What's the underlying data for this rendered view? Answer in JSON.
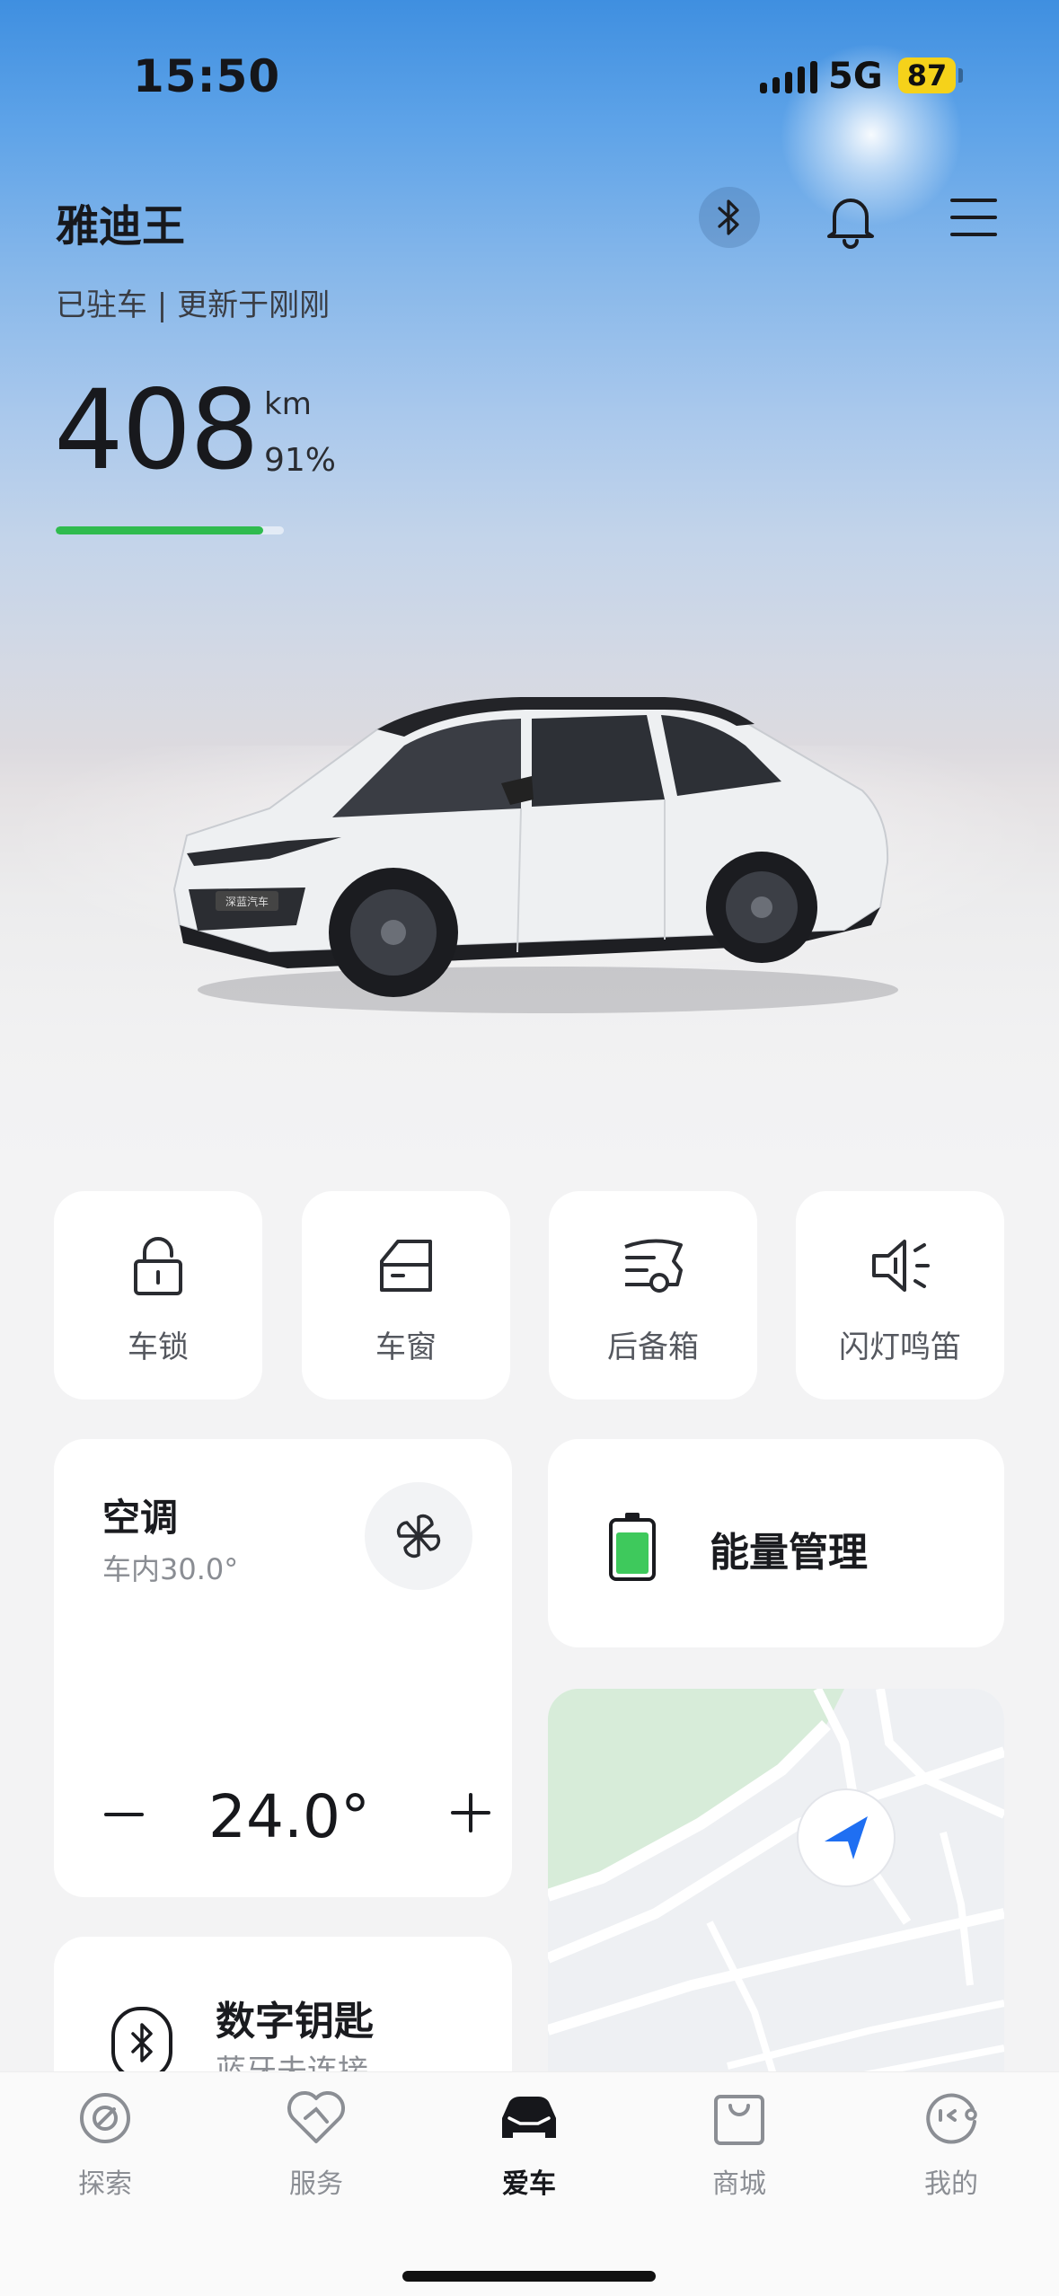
{
  "status_bar": {
    "time": "15:50",
    "network": "5G",
    "battery": "87",
    "battery_color": "#f5d21a"
  },
  "header": {
    "car_name": "雅迪王",
    "status": "已驻车 | 更新于刚刚",
    "icons": [
      "bluetooth-icon",
      "bell-icon",
      "menu-icon"
    ]
  },
  "range": {
    "value": "408",
    "unit": "km",
    "battery_percent": "91%",
    "bar_fill_percent": 91,
    "bar_color": "#2fbb4f"
  },
  "car_image": {
    "badge_text": "深蓝汽车"
  },
  "quick_actions": [
    {
      "label": "车锁",
      "icon": "lock-icon"
    },
    {
      "label": "车窗",
      "icon": "car-window-icon"
    },
    {
      "label": "后备箱",
      "icon": "trunk-icon"
    },
    {
      "label": "闪灯鸣笛",
      "icon": "horn-light-icon"
    }
  ],
  "climate": {
    "title": "空调",
    "cabin_temp": "车内30.0°",
    "set_temp": "24.0°",
    "icon": "fan-icon"
  },
  "energy": {
    "label": "能量管理",
    "icon": "battery-icon"
  },
  "map": {
    "icon": "navigation-arrow-icon"
  },
  "digital_key": {
    "title": "数字钥匙",
    "subtitle": "蓝牙未连接",
    "icon": "bluetooth-key-icon"
  },
  "tabbar": {
    "tabs": [
      {
        "label": "探索",
        "icon": "explore-icon",
        "active": false
      },
      {
        "label": "服务",
        "icon": "service-icon",
        "active": false
      },
      {
        "label": "爱车",
        "icon": "car-icon",
        "active": true
      },
      {
        "label": "商城",
        "icon": "shop-bag-icon",
        "active": false
      },
      {
        "label": "我的",
        "icon": "profile-icon",
        "active": false
      }
    ]
  }
}
